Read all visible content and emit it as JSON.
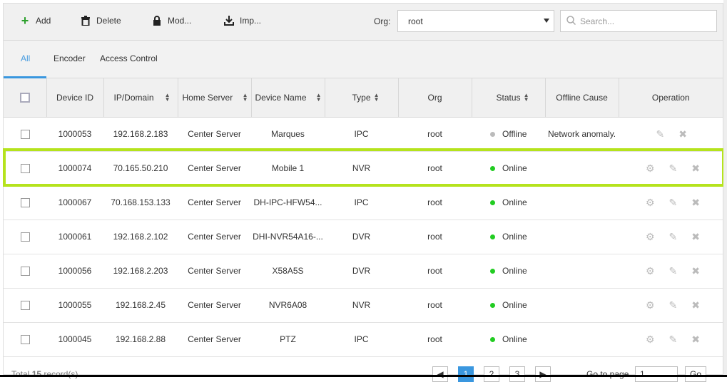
{
  "toolbar": {
    "add": "Add",
    "delete": "Delete",
    "modify": "Mod...",
    "import": "Imp...",
    "org_label": "Org:",
    "org_value": "root",
    "search_placeholder": "Search..."
  },
  "tabs": [
    "All",
    "Encoder",
    "Access Control"
  ],
  "columns": [
    "Device ID",
    "IP/Domain",
    "Home Server",
    "Device Name",
    "Type",
    "Org",
    "Status",
    "Offline Cause",
    "Operation"
  ],
  "rows": [
    {
      "id": "1000053",
      "ip": "192.168.2.183",
      "server": "Center Server",
      "name": "Marques",
      "type": "IPC",
      "org": "root",
      "status": "Offline",
      "cause": "Network anomaly."
    },
    {
      "id": "1000074",
      "ip": "70.165.50.210",
      "server": "Center Server",
      "name": "Mobile 1",
      "type": "NVR",
      "org": "root",
      "status": "Online",
      "cause": ""
    },
    {
      "id": "1000067",
      "ip": "70.168.153.133",
      "server": "Center Server",
      "name": "DH-IPC-HFW54...",
      "type": "IPC",
      "org": "root",
      "status": "Online",
      "cause": ""
    },
    {
      "id": "1000061",
      "ip": "192.168.2.102",
      "server": "Center Server",
      "name": "DHI-NVR54A16-...",
      "type": "DVR",
      "org": "root",
      "status": "Online",
      "cause": ""
    },
    {
      "id": "1000056",
      "ip": "192.168.2.203",
      "server": "Center Server",
      "name": "X58A5S",
      "type": "DVR",
      "org": "root",
      "status": "Online",
      "cause": ""
    },
    {
      "id": "1000055",
      "ip": "192.168.2.45",
      "server": "Center Server",
      "name": "NVR6A08",
      "type": "NVR",
      "org": "root",
      "status": "Online",
      "cause": ""
    },
    {
      "id": "1000045",
      "ip": "192.168.2.88",
      "server": "Center Server",
      "name": "PTZ",
      "type": "IPC",
      "org": "root",
      "status": "Online",
      "cause": ""
    }
  ],
  "footer": {
    "total_prefix": "Total",
    "total": "15",
    "total_suffix": "record(s)",
    "pages": [
      "1",
      "2",
      "3"
    ],
    "goto_label": "Go to page",
    "goto_value": "1",
    "go": "Go"
  },
  "colors": {
    "online": "#22cc22",
    "offline": "#bbbbbb",
    "accent": "#3a97df",
    "highlight": "#b5e31d"
  }
}
